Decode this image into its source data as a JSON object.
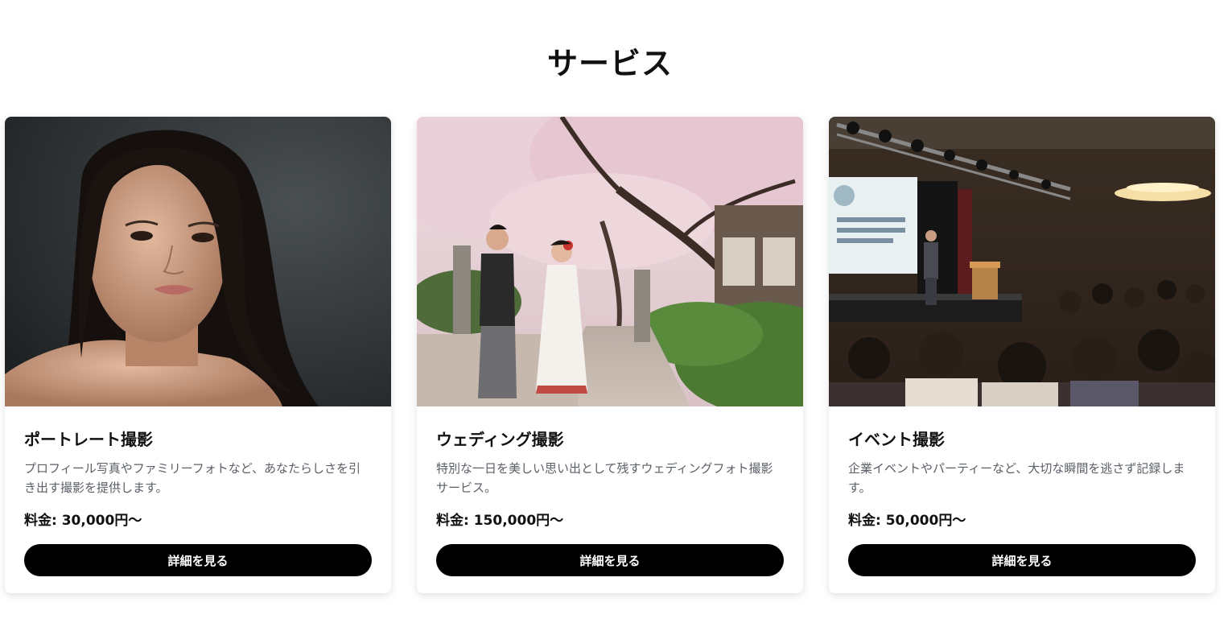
{
  "section": {
    "title": "サービス"
  },
  "services": [
    {
      "image_subject": "portrait-photo",
      "title": "ポートレート撮影",
      "description": "プロフィール写真やファミリーフォトなど、あなたらしさを引き出す撮影を提供します。",
      "price_label": "料金: ",
      "price": "30,000円〜",
      "button_label": "詳細を見る"
    },
    {
      "image_subject": "wedding-photo",
      "title": "ウェディング撮影",
      "description": "特別な一日を美しい思い出として残すウェディングフォト撮影サービス。",
      "price_label": "料金: ",
      "price": "150,000円〜",
      "button_label": "詳細を見る"
    },
    {
      "image_subject": "event-photo",
      "title": "イベント撮影",
      "description": "企業イベントやパーティーなど、大切な瞬間を逃さず記録します。",
      "price_label": "料金: ",
      "price": "50,000円〜",
      "button_label": "詳細を見る"
    }
  ],
  "colors": {
    "button_bg": "#000000",
    "button_text": "#ffffff",
    "description_text": "#5a5f66",
    "card_bg": "#ffffff"
  }
}
